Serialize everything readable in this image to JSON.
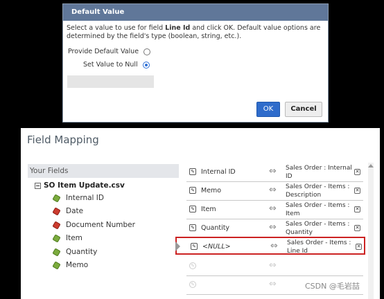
{
  "dialog": {
    "title": "Default Value",
    "message_prefix": "Select a value to use for field ",
    "field_name": "Line Id",
    "message_suffix": " and click OK. Default value options are determined by the field's type (boolean, string, etc.).",
    "option_provide": "Provide Default Value",
    "option_null": "Set Value to Null",
    "ok_label": "OK",
    "cancel_label": "Cancel"
  },
  "panel": {
    "title": "Field Mapping",
    "your_fields_header": "Your Fields",
    "file_name": "SO Item Update.csv",
    "fields": [
      {
        "label": "Internal ID",
        "icon": "green-tag-icon"
      },
      {
        "label": "Date",
        "icon": "red-tag-icon"
      },
      {
        "label": "Document Number",
        "icon": "red-tag-icon"
      },
      {
        "label": "Item",
        "icon": "green-tag-icon"
      },
      {
        "label": "Quantity",
        "icon": "green-tag-icon"
      },
      {
        "label": "Memo",
        "icon": "green-tag-icon"
      }
    ],
    "mappings": [
      {
        "source": "Internal ID",
        "dest": "Sales Order : Internal ID"
      },
      {
        "source": "Memo",
        "dest": "Sales Order - Items : Description"
      },
      {
        "source": "Item",
        "dest": "Sales Order - Items : Item"
      },
      {
        "source": "Quantity",
        "dest": "Sales Order - Items : Quantity"
      },
      {
        "source": "<NULL>",
        "dest": "Sales Order - Items : Line Id"
      }
    ]
  },
  "watermark": "CSDN @毛岩喆",
  "colors": {
    "title_bar": "#607799",
    "ok_button": "#2f6ccb",
    "highlight_border": "#cc2222"
  }
}
